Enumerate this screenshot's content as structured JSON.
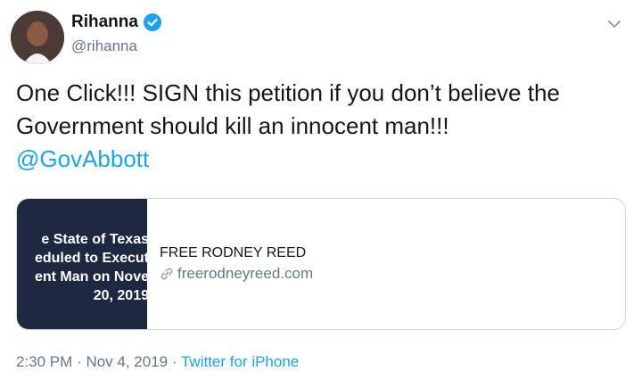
{
  "user": {
    "display_name": "Rihanna",
    "handle": "@rihanna"
  },
  "tweet": {
    "text_line1": "One Click!!! SIGN this petition if you don’t believe the",
    "text_line2": "Government should kill an innocent man!!!",
    "mention": "@GovAbbott"
  },
  "card": {
    "image_text": "e State of Texas\neduled to Execut\nent Man on Nove\n20, 2019",
    "title": "FREE RODNEY REED",
    "domain": "freerodneyreed.com"
  },
  "meta": {
    "time": "2:30 PM",
    "separator1": "·",
    "date": "Nov 4, 2019",
    "separator2": "·",
    "source": "Twitter for iPhone"
  },
  "colors": {
    "accent": "#1da1f2",
    "secondary_text": "#657786",
    "card_image_bg": "#1c2940"
  },
  "icons": [
    "verified-badge-icon",
    "chevron-down-icon",
    "link-icon"
  ]
}
